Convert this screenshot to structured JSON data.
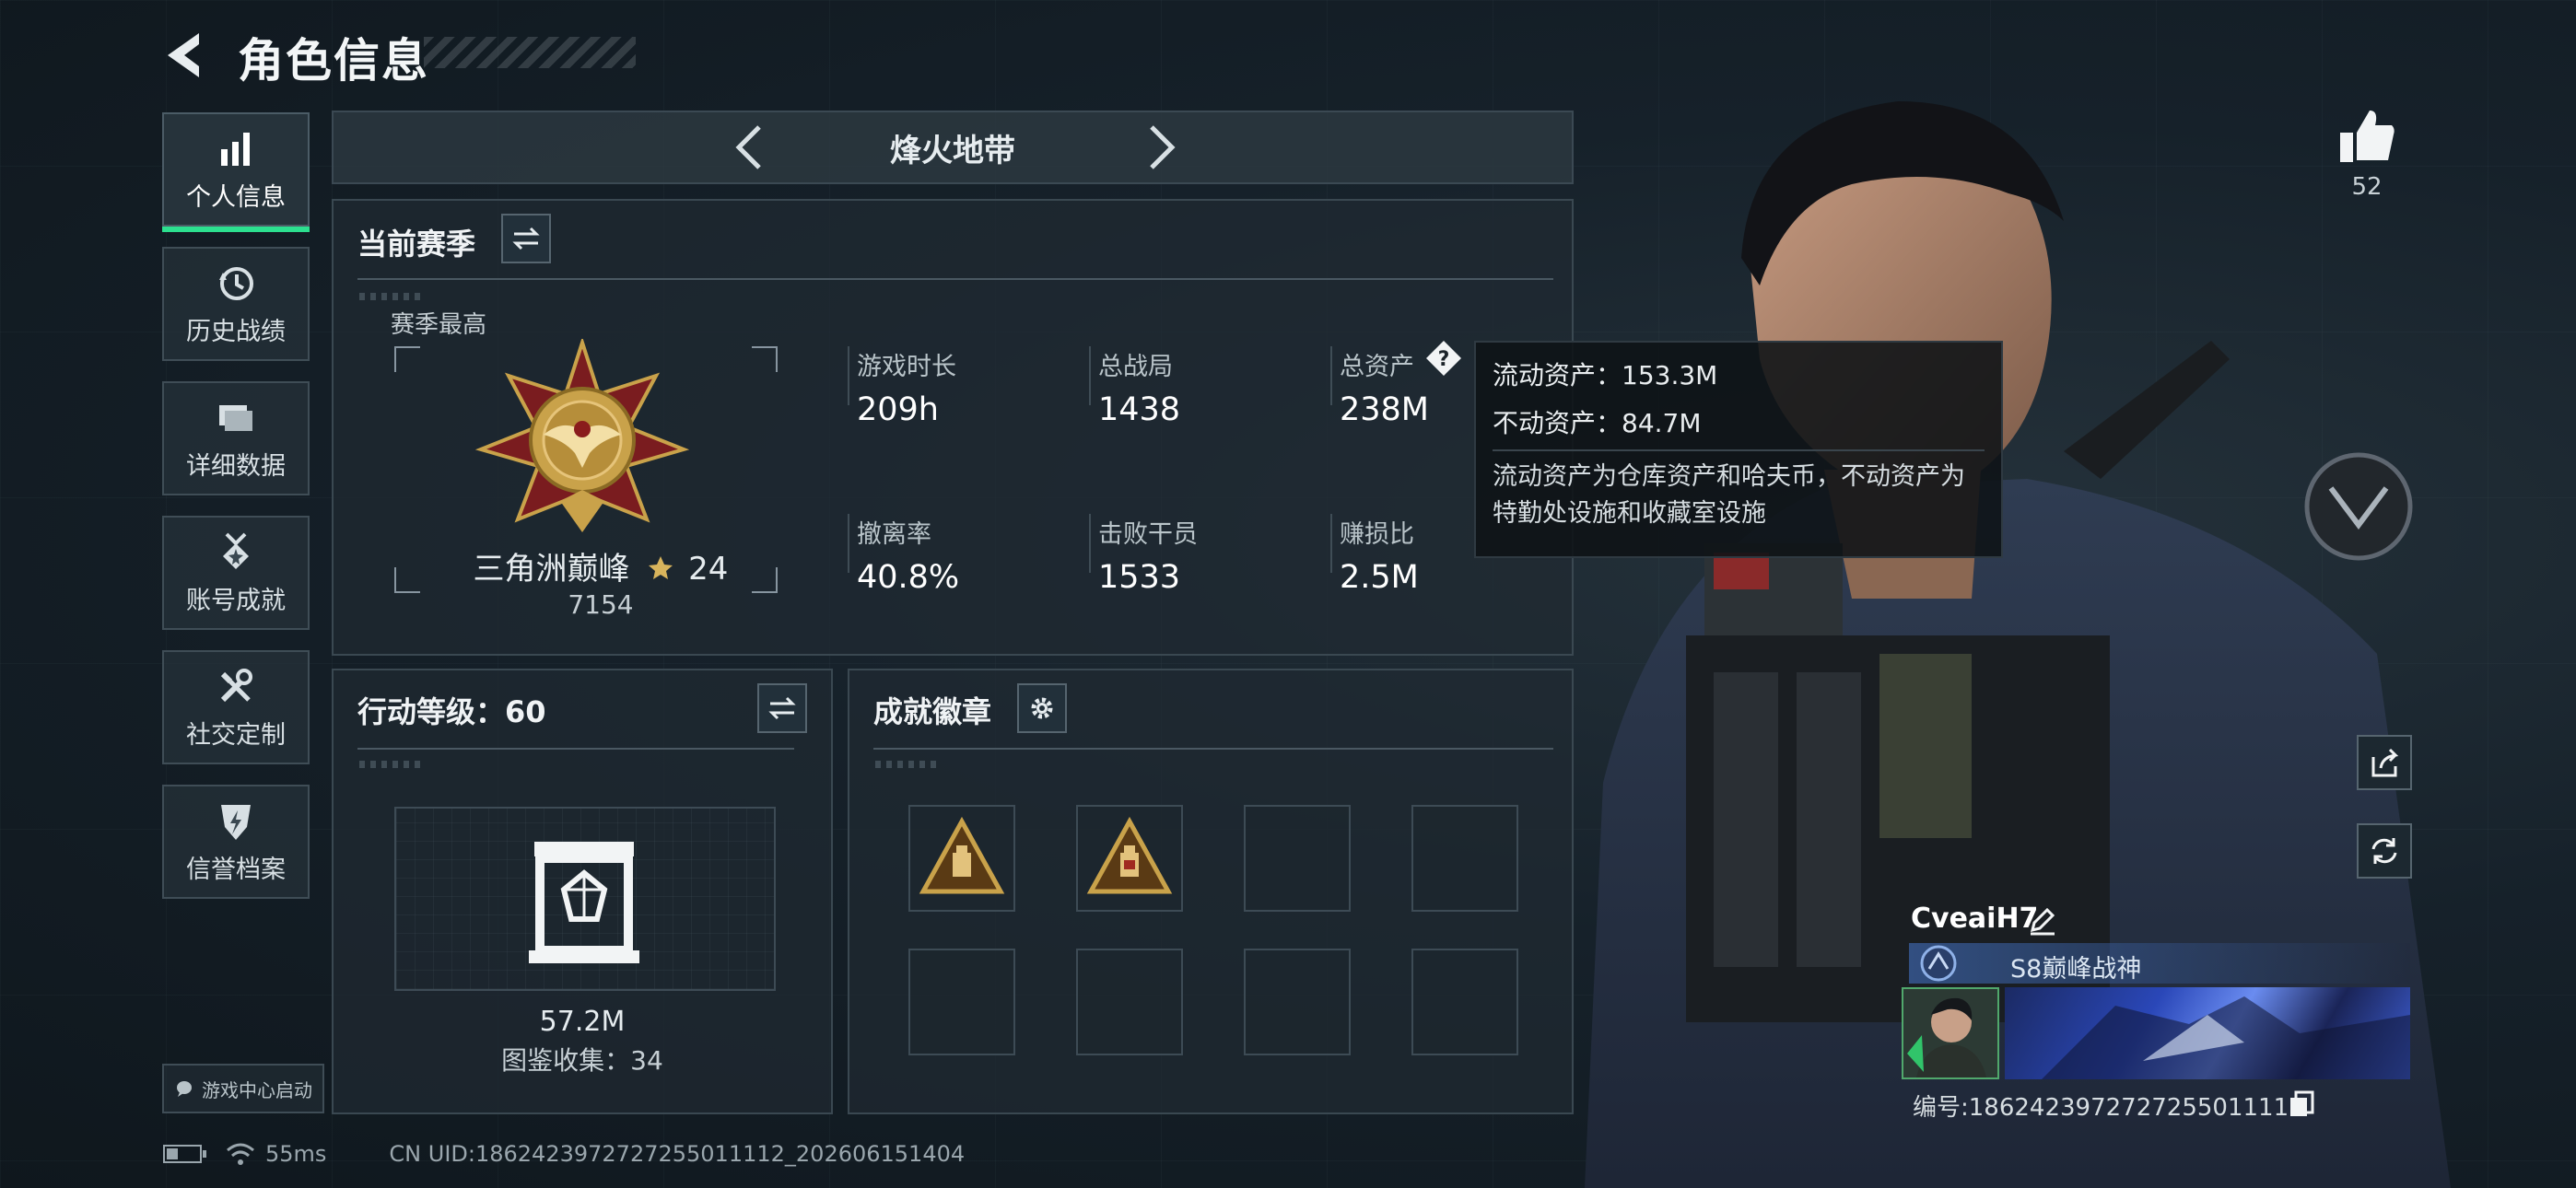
{
  "header": {
    "title": "角色信息"
  },
  "nav": {
    "items": [
      {
        "label": "个人信息",
        "icon": "bar-chart-icon",
        "active": true
      },
      {
        "label": "历史战绩",
        "icon": "history-clock-icon"
      },
      {
        "label": "详细数据",
        "icon": "folder-icon"
      },
      {
        "label": "账号成就",
        "icon": "medal-icon"
      },
      {
        "label": "社交定制",
        "icon": "tools-icon"
      },
      {
        "label": "信誉档案",
        "icon": "shield-bolt-icon"
      }
    ],
    "game_center": "游戏中心启动"
  },
  "mode": {
    "title": "烽火地带"
  },
  "season": {
    "title": "当前赛季",
    "best_label": "赛季最高",
    "rank_name": "三角洲巅峰",
    "rank_stars": "24",
    "rank_score": "7154",
    "stats": [
      {
        "label": "游戏时长",
        "value": "209h"
      },
      {
        "label": "总战局",
        "value": "1438"
      },
      {
        "label": "总资产",
        "value": "238M"
      },
      {
        "label": "撤离率",
        "value": "40.8%"
      },
      {
        "label": "击败干员",
        "value": "1533"
      },
      {
        "label": "赚损比",
        "value": "2.5M"
      }
    ]
  },
  "tooltip": {
    "liquid": "流动资产：153.3M",
    "fixed": "不动资产：84.7M",
    "desc": "流动资产为仓库资产和哈夫币，不动资产为特勤处设施和收藏室设施"
  },
  "action_level": {
    "title": "行动等级：60",
    "value": "57.2M",
    "collection": "图鉴收集：34"
  },
  "achievements": {
    "title": "成就徽章",
    "filled_badges": 2,
    "total_slots": 8
  },
  "profile": {
    "likes": "52",
    "name": "CveaiH7",
    "rank_title": "S8巅峰战神",
    "serial": "编号:1862423972727255011112"
  },
  "status": {
    "ping": "55ms",
    "uid": "CN UID:1862423972727255011112_202606151404"
  },
  "colors": {
    "accent": "#2ce08f",
    "gold": "#c9a24a"
  }
}
